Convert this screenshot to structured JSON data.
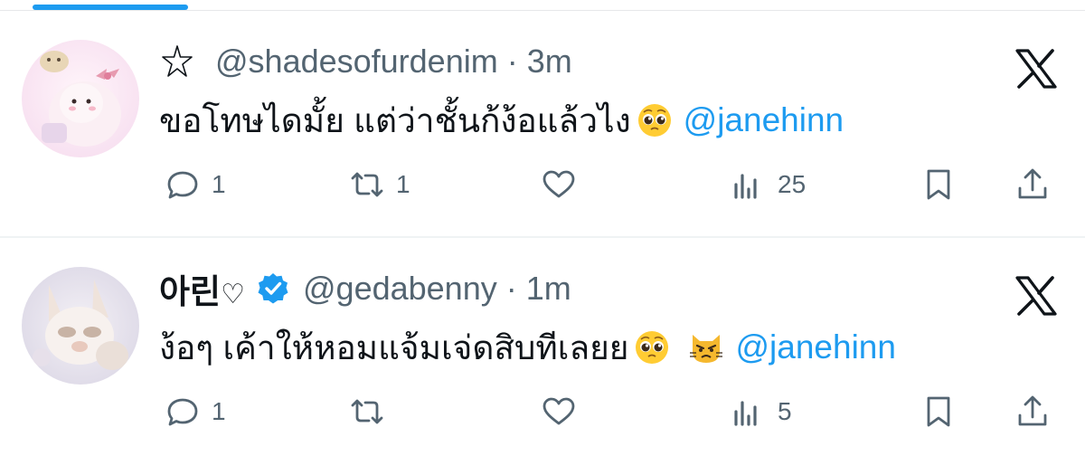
{
  "colors": {
    "accent": "#1d9bf0",
    "text_primary": "#0f1419",
    "text_secondary": "#536471"
  },
  "tweets": [
    {
      "display_name": "",
      "prefix_icon": "star-outline-icon",
      "verified": false,
      "handle": "@shadesofurdenim",
      "separator": "·",
      "time": "3m",
      "text": "ขอโทษไดมั้ย แต่ว่าชั้นก้ง้อแล้วไง",
      "emojis": [
        "pleading-face-emoji"
      ],
      "mention": "@janehinn",
      "reply_count": "1",
      "retweet_count": "1",
      "like_count": "",
      "view_count": "25"
    },
    {
      "display_name": "아린",
      "name_suffix": "♡",
      "verified": true,
      "handle": "@gedabenny",
      "separator": "·",
      "time": "1m",
      "text": "ง้อๆ เค้าให้หอมแจ้มเจ่ดสิบทีเลยย",
      "emojis": [
        "pleading-face-emoji",
        "pouting-cat-emoji"
      ],
      "mention": "@janehinn",
      "reply_count": "1",
      "retweet_count": "",
      "like_count": "",
      "view_count": "5"
    }
  ]
}
